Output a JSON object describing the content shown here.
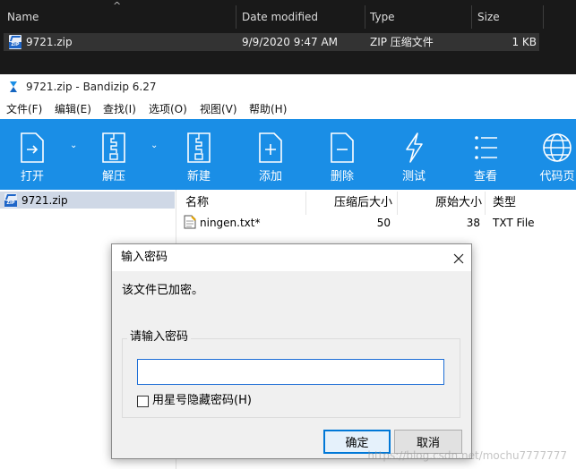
{
  "explorer": {
    "columns": [
      "Name",
      "Date modified",
      "Type",
      "Size"
    ],
    "file": {
      "name": "9721.zip",
      "date": "9/9/2020 9:47 AM",
      "type": "ZIP 压缩文件",
      "size": "1 KB"
    }
  },
  "bandizip": {
    "title": "9721.zip - Bandizip 6.27",
    "menu": [
      "文件(F)",
      "编辑(E)",
      "查找(I)",
      "选项(O)",
      "视图(V)",
      "帮助(H)"
    ],
    "toolbar": [
      "打开",
      "解压",
      "新建",
      "添加",
      "删除",
      "测试",
      "查看",
      "代码页"
    ],
    "tree_item": "9721.zip",
    "list_columns": [
      "名称",
      "压缩后大小",
      "原始大小",
      "类型"
    ],
    "files": [
      {
        "name": "ningen.txt*",
        "compressed": "50",
        "original": "38",
        "type": "TXT File"
      }
    ]
  },
  "dialog": {
    "title": "输入密码",
    "message": "该文件已加密。",
    "group_label": "请输入密码",
    "password_value": "",
    "hide_label": "用星号隐藏密码(H)",
    "hide_checked": false,
    "ok_label": "确定",
    "cancel_label": "取消"
  },
  "watermark": "https://blog.csdn.net/mochu7777777",
  "colors": {
    "toolbar": "#1a8ee6",
    "explorer_bg": "#191919",
    "accent": "#0078d7"
  }
}
